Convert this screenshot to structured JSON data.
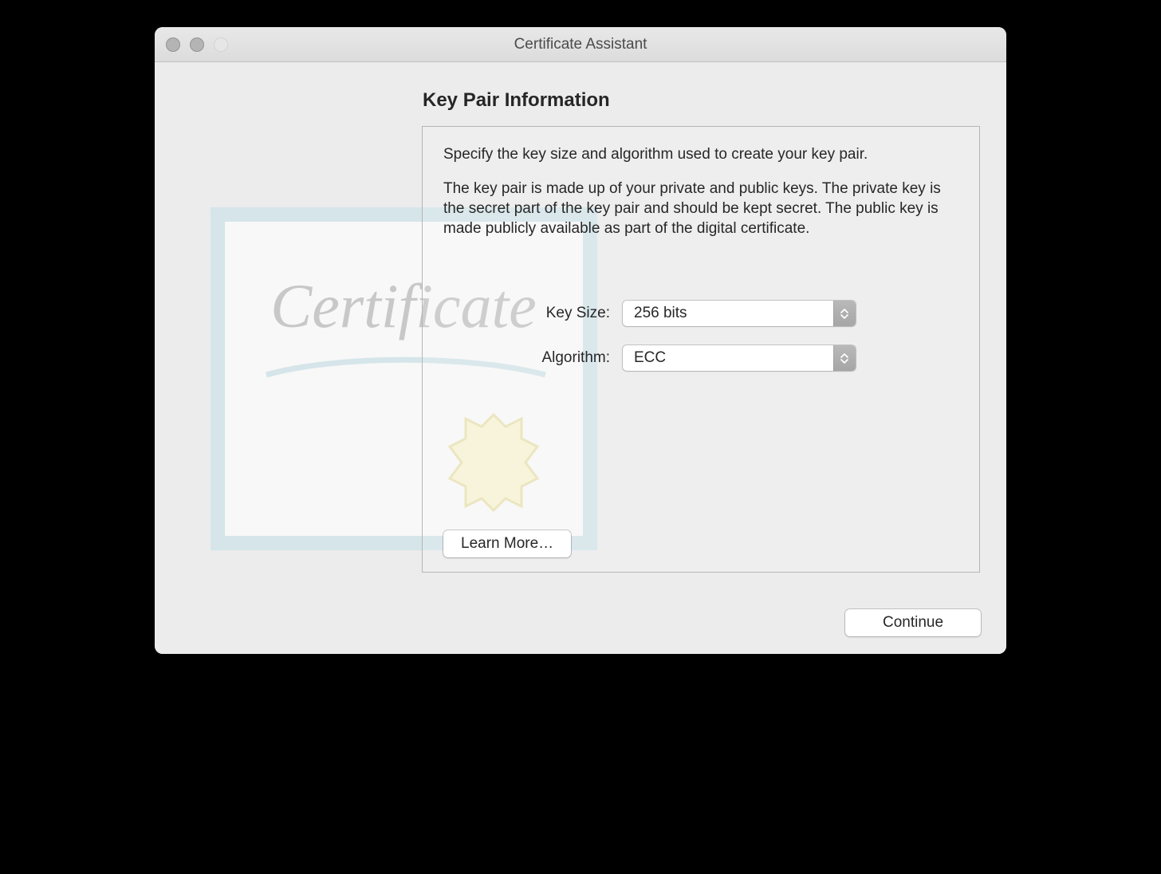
{
  "window": {
    "title": "Certificate Assistant"
  },
  "page": {
    "heading": "Key Pair Information",
    "intro": "Specify the key size and algorithm used to create your key pair.",
    "description": "The key pair is made up of your private and public keys. The private key is the secret part of the key pair and should be kept secret. The public key is made publicly available as part of the digital certificate."
  },
  "form": {
    "key_size": {
      "label": "Key Size:",
      "value": "256 bits"
    },
    "algorithm": {
      "label": "Algorithm:",
      "value": "ECC"
    }
  },
  "buttons": {
    "learn_more": "Learn More…",
    "continue": "Continue"
  },
  "art": {
    "word": "Certificate"
  }
}
